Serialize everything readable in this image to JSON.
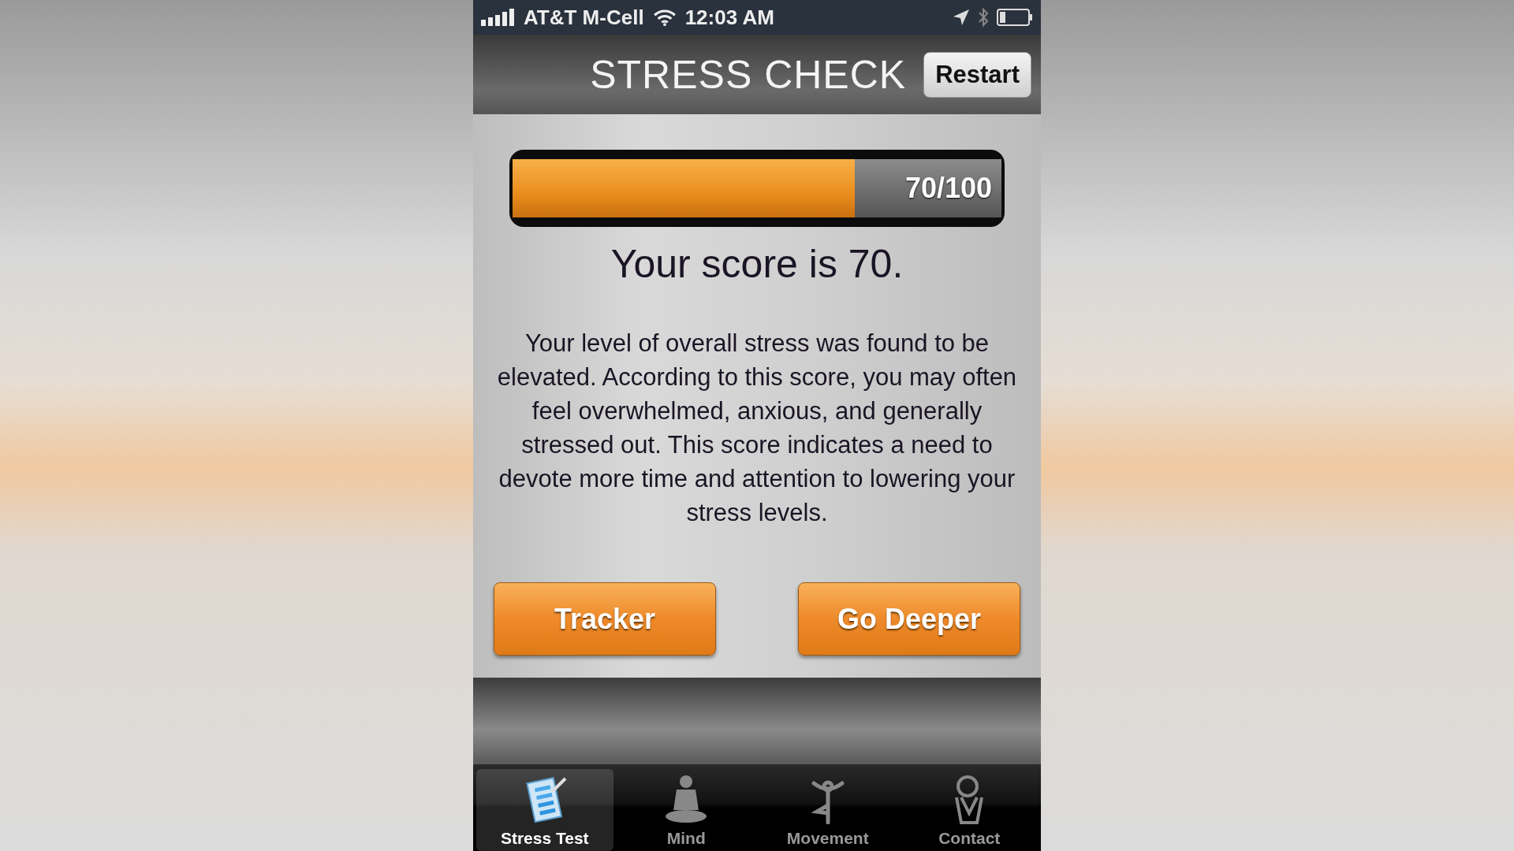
{
  "status_bar": {
    "carrier": "AT&T M-Cell",
    "time": "12:03 AM"
  },
  "nav_bar": {
    "title": "STRESS CHECK",
    "button": "Restart"
  },
  "score_bar": {
    "level": 0.7,
    "reading": "70/100"
  },
  "score_text": "Your score is 70.",
  "description": "Your level of overall stress was found to be elevated. According to this score, you may often feel overwhelmed, anxious, and generally stressed out. This score indicates a need to devote more time and attention to lowering your stress levels.",
  "buttons": [
    "Tracker",
    "Go Deeper"
  ],
  "tabs": [
    {
      "label": "Stress Test",
      "kind": "checklist",
      "selected": true
    },
    {
      "label": "Mind",
      "kind": "meditation",
      "selected": false
    },
    {
      "label": "Movement",
      "kind": "yoga",
      "selected": false
    },
    {
      "label": "Contact",
      "kind": "person",
      "selected": false
    }
  ]
}
